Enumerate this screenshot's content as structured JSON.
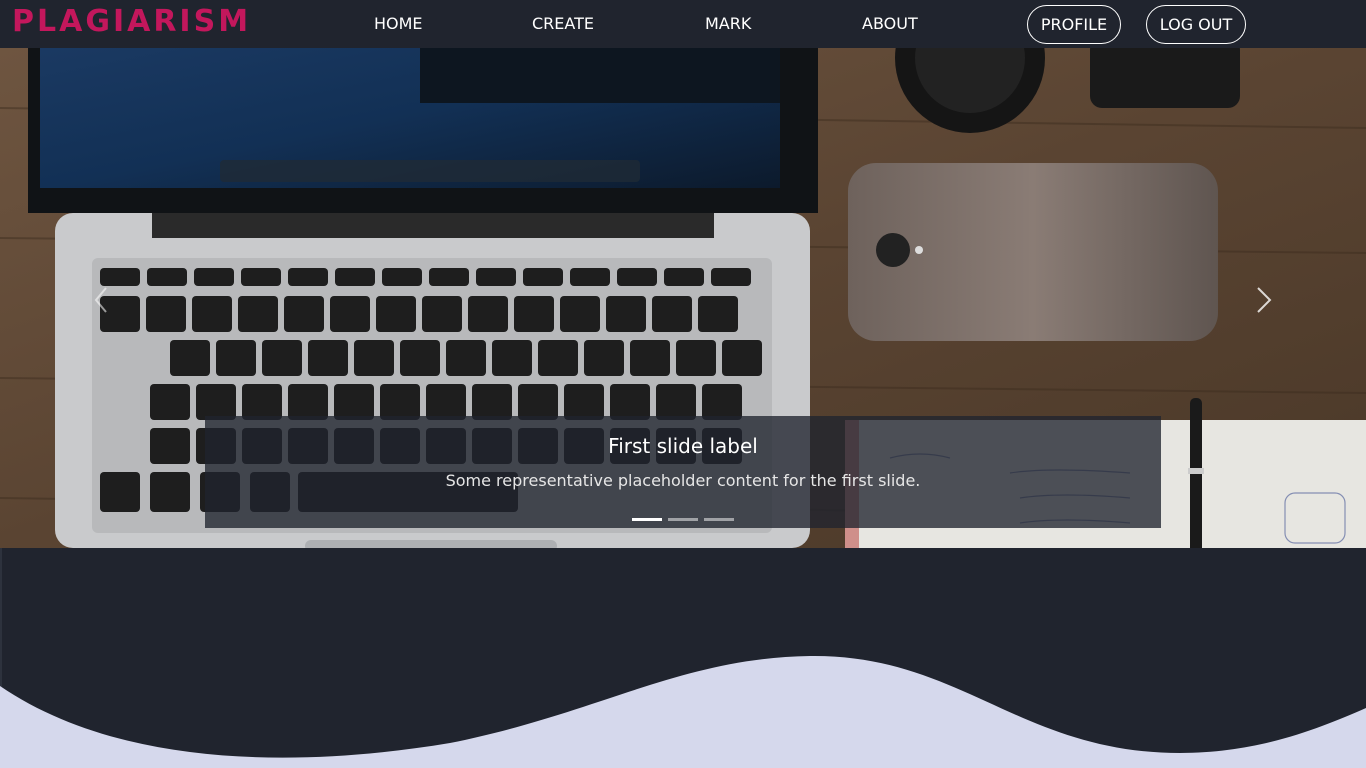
{
  "brand": "PLAGIARISM",
  "nav": {
    "home": "HOME",
    "create": "CREATE",
    "mark": "MARK",
    "about": "ABOUT",
    "profile": "PROFILE",
    "logout": "LOG OUT"
  },
  "carousel": {
    "slides": [
      {
        "title": "First slide label",
        "text": "Some representative placeholder content for the first slide."
      }
    ],
    "indicator_count": 3,
    "active_index": 0,
    "prev_icon": "chevron-left-icon",
    "next_icon": "chevron-right-icon"
  },
  "colors": {
    "brand": "#c3175c",
    "navbar": "#20242e",
    "wave": "#d5d8ec"
  }
}
